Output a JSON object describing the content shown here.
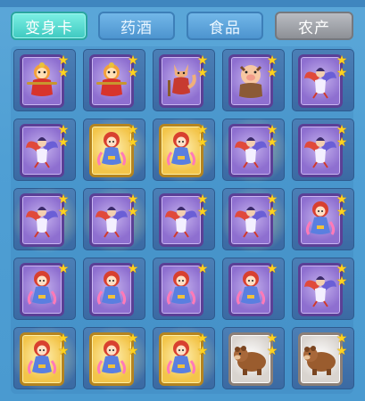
{
  "tabs": [
    {
      "label": "变身卡",
      "state": "active"
    },
    {
      "label": "药酒",
      "state": "normal"
    },
    {
      "label": "食品",
      "state": "normal"
    },
    {
      "label": "农产",
      "state": "gray"
    }
  ],
  "colors": {
    "star": "#ffd21f",
    "active_tab": "#3ec9c0",
    "slot": "#3b6aa3"
  },
  "items": [
    {
      "card": "purple",
      "figure": "monkey-king",
      "stars": 2,
      "glow": false
    },
    {
      "card": "purple",
      "figure": "monkey-king",
      "stars": 2,
      "glow": false
    },
    {
      "card": "purple",
      "figure": "fox-spirit",
      "stars": 2,
      "glow": false
    },
    {
      "card": "purple",
      "figure": "pig-spirit",
      "stars": 2,
      "glow": false
    },
    {
      "card": "purple",
      "figure": "phoenix-spirit",
      "stars": 2,
      "glow": false
    },
    {
      "card": "purple",
      "figure": "phoenix-spirit",
      "stars": 2,
      "glow": false
    },
    {
      "card": "gold",
      "figure": "red-hair-girl",
      "stars": 2,
      "glow": true
    },
    {
      "card": "gold",
      "figure": "red-hair-girl",
      "stars": 2,
      "glow": true
    },
    {
      "card": "purple",
      "figure": "phoenix-spirit",
      "stars": 2,
      "glow": true
    },
    {
      "card": "purple",
      "figure": "phoenix-spirit",
      "stars": 2,
      "glow": false
    },
    {
      "card": "purple",
      "figure": "phoenix-spirit",
      "stars": 2,
      "glow": true
    },
    {
      "card": "purple",
      "figure": "phoenix-spirit",
      "stars": 2,
      "glow": true
    },
    {
      "card": "purple",
      "figure": "phoenix-spirit",
      "stars": 2,
      "glow": false
    },
    {
      "card": "purple",
      "figure": "phoenix-spirit",
      "stars": 2,
      "glow": true
    },
    {
      "card": "purple",
      "figure": "red-hair-girl",
      "stars": 2,
      "glow": false
    },
    {
      "card": "purple",
      "figure": "red-hair-girl",
      "stars": 1,
      "glow": false
    },
    {
      "card": "purple",
      "figure": "red-hair-girl",
      "stars": 1,
      "glow": false
    },
    {
      "card": "purple",
      "figure": "red-hair-girl",
      "stars": 1,
      "glow": false
    },
    {
      "card": "purple",
      "figure": "red-hair-girl",
      "stars": 1,
      "glow": false
    },
    {
      "card": "purple",
      "figure": "phoenix-spirit",
      "stars": 2,
      "glow": false
    },
    {
      "card": "gold",
      "figure": "red-hair-girl",
      "stars": 2,
      "glow": true
    },
    {
      "card": "gold",
      "figure": "red-hair-girl",
      "stars": 2,
      "glow": true
    },
    {
      "card": "gold",
      "figure": "red-hair-girl",
      "stars": 2,
      "glow": true
    },
    {
      "card": "white",
      "figure": "brown-bear",
      "stars": 2,
      "glow": false
    },
    {
      "card": "white",
      "figure": "brown-bear",
      "stars": 2,
      "glow": false
    }
  ]
}
